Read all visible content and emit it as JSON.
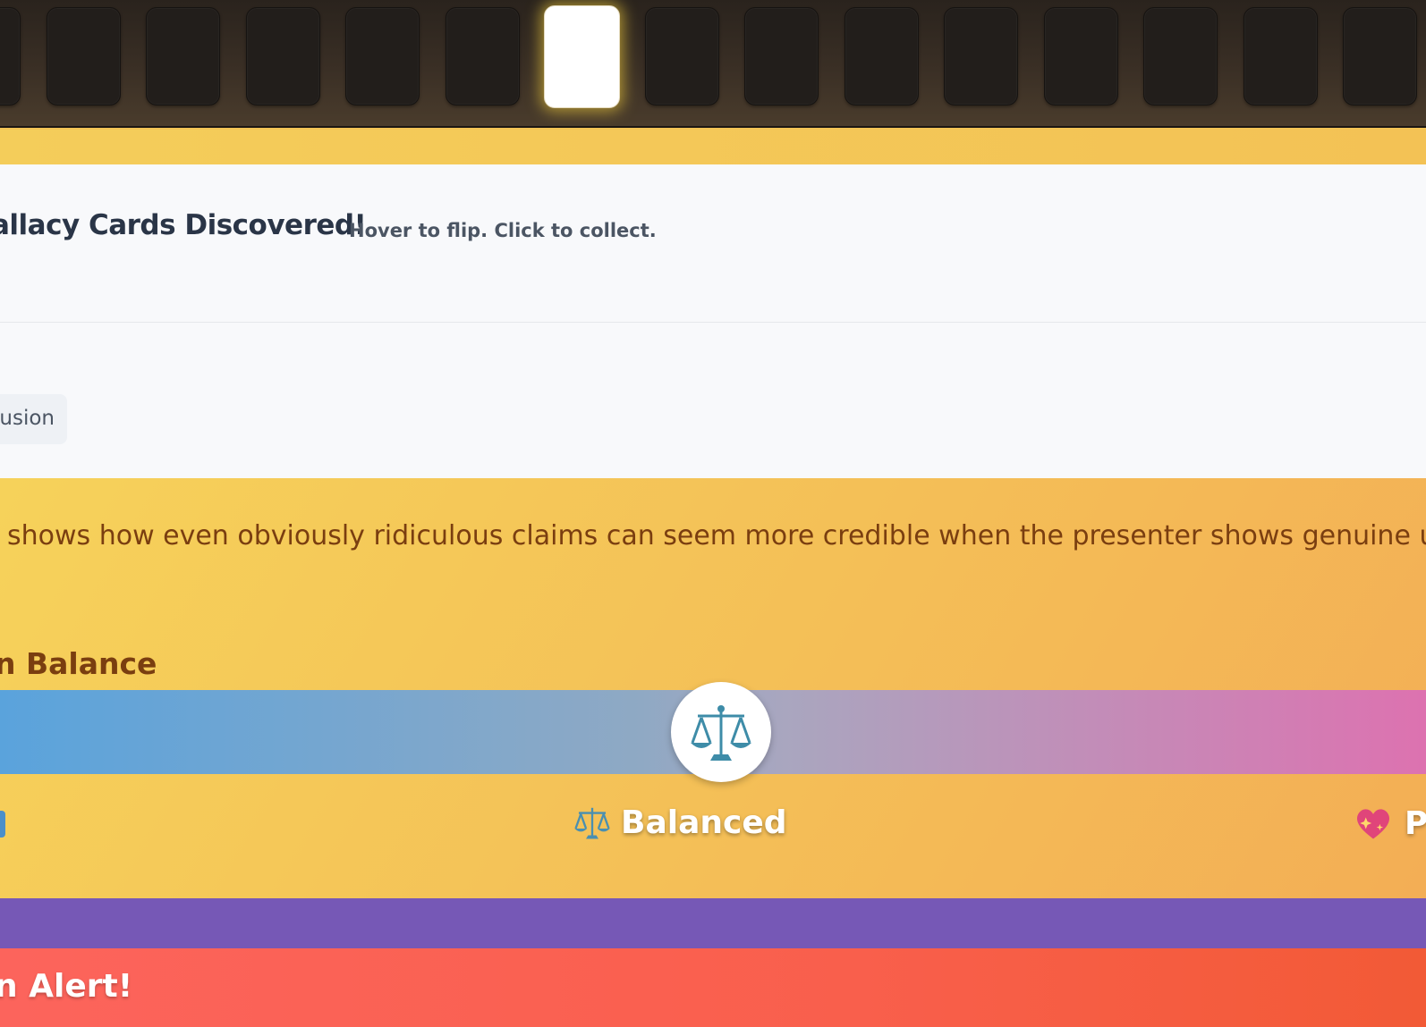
{
  "cards": {
    "count": 15,
    "active_index": 6
  },
  "discovery": {
    "title": "allacy Cards Discovered!",
    "hint": "Hover to flip. Click to collect."
  },
  "chip": {
    "label": "usion"
  },
  "explanation": {
    "text": " shows how even obviously ridiculous claims can seem more credible when the presenter shows genuine un"
  },
  "balance": {
    "section_title": "n Balance",
    "center_icon": "scales-icon",
    "center_label": "Balanced",
    "right_label": "P",
    "right_icon": "sparkling-heart-icon",
    "level": 0.5
  },
  "alert": {
    "title": "n Alert!"
  },
  "colors": {
    "bar_left": "#5aa3dc",
    "bar_right": "#dd72b0",
    "alert": "#fc645c",
    "purple": "#7658b6",
    "text_brown": "#7a3e10"
  }
}
